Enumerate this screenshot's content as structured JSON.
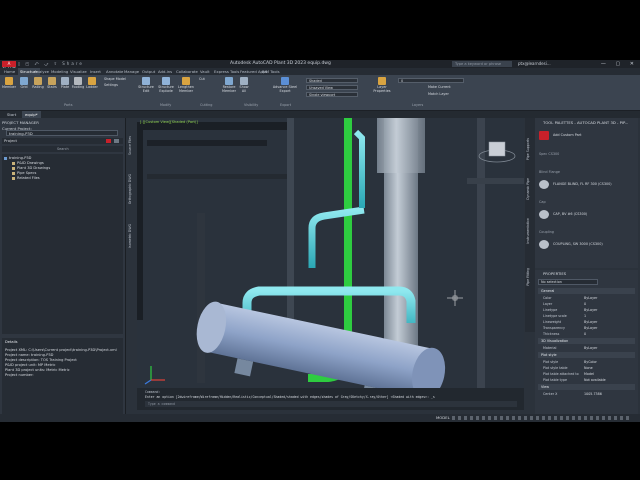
{
  "app": {
    "logo": "A PLANT",
    "title": "Autodesk AutoCAD Plant 3D 2023   equip.dwg",
    "search_placeholder": "Type a keyword or phrase",
    "user": "ptx@learndesi...",
    "window_buttons": "— ▢ ✕",
    "qat": "▯ ◰ ⤺ ⤻ ⇪ Share"
  },
  "ribbon_tabs": [
    "Home",
    "Structure",
    "Analyze",
    "Modeling",
    "Visualize",
    "Insert",
    "Annotate",
    "Manage",
    "Output",
    "Add-ins",
    "Collaborate",
    "Vault",
    "Express Tools",
    "Featured Apps",
    "BIM Tools"
  ],
  "active_tab": "Structure",
  "ribbon": {
    "buttons": {
      "member": "Member",
      "grid": "Grid",
      "railing": "Railing",
      "stairs": "Stairs",
      "plate": "Plate",
      "footing": "Footing",
      "ladder": "Ladder",
      "edit": "Structure Edit",
      "explode": "Structure Explode",
      "lengthen": "Lengthen Member",
      "restore": "Restore Member",
      "show_all": "Show All",
      "export": "Advance Steel Export",
      "layer_props": "Layer Properties"
    },
    "shape_model": "Shape Model",
    "settings": "Settings",
    "cutting_cut": "Cut",
    "visual_style": "Shaded",
    "view_name": "Unsaved View",
    "viewport_cfg": "Single viewport",
    "export_xml": "Export XML",
    "make_current": "Make Current",
    "match_layer": "Match Layer",
    "layer_value": "0",
    "panels": [
      "Parts",
      "Modify",
      "Cutting",
      "Visibility",
      "Export",
      "Layers"
    ]
  },
  "doc_tabs": [
    "Start",
    "equip*"
  ],
  "project_manager": {
    "title": "PROJECT MANAGER",
    "current_project_label": "Current Project:",
    "current_project": "training-P3D",
    "project_label": "Project",
    "search": "Search",
    "tree": [
      "training-P3D",
      "P&ID Drawings",
      "Plant 3D Drawings",
      "Pipe Specs",
      "Related Files"
    ],
    "details_title": "Details",
    "details": [
      "Project XML: C:\\Users\\Current project\\training-P3D\\Project.xml",
      "Project name: training-P3D",
      "Project description: TOS Training Project",
      "P&ID project unit: MP Metric",
      "Plant 3D project units: Metric Metric",
      "Project number:"
    ]
  },
  "side_tabs": [
    "Source Files",
    "Orthographic DWG",
    "Isometric DWG"
  ],
  "viewport": {
    "label": "[-][Custom View][Shaded (Part)]"
  },
  "tool_palettes": {
    "title": "TOOL PALETTES - AUTOCAD PLANT 3D - PIP...",
    "items": [
      {
        "label": "Add Custom Part",
        "section": ""
      },
      {
        "label": "",
        "section": "Spec CS300"
      },
      {
        "label": "FLANGE BLIND, FL RF 300 (CS300)",
        "section": "Blind Flange"
      },
      {
        "label": "CAP, BV #6 (CS300)",
        "section": "Cap"
      },
      {
        "label": "COUPLING, SW 3000 (CS300)",
        "section": "Coupling"
      }
    ],
    "vertical_tabs": [
      "Pipe Supports",
      "Dynamic Pipe",
      "Instrumentation",
      "Pipe Fitting"
    ]
  },
  "properties": {
    "title": "PROPERTIES",
    "selection": "No selection",
    "groups": [
      {
        "name": "General",
        "rows": [
          [
            "Color",
            "ByLayer"
          ],
          [
            "Layer",
            "0"
          ],
          [
            "Linetype",
            "ByLayer"
          ],
          [
            "Linetype scale",
            "1"
          ],
          [
            "Lineweight",
            "ByLayer"
          ],
          [
            "Transparency",
            "ByLayer"
          ],
          [
            "Thickness",
            "0"
          ]
        ]
      },
      {
        "name": "3D Visualization",
        "rows": [
          [
            "Material",
            "ByLayer"
          ]
        ]
      },
      {
        "name": "Plot style",
        "rows": [
          [
            "Plot style",
            "ByColor"
          ],
          [
            "Plot style table",
            "None"
          ],
          [
            "Plot table attached to",
            "Model"
          ],
          [
            "Plot table type",
            "Not available"
          ]
        ]
      },
      {
        "name": "View",
        "rows": [
          [
            "Center X",
            "1005.7386"
          ]
        ]
      }
    ]
  },
  "command": {
    "line1": "Command:",
    "line2": "Enter an option [2dwireframe/Wireframe/Hidden/Realistic/Conceptual/Shaded/shaded with edges/shades of Gray/SKetchy/X-ray/Other] <Shaded with edges>: _s",
    "input_placeholder": "Type a command"
  },
  "status": {
    "left": "",
    "model": "MODEL"
  },
  "colors": {
    "equipment": "#8ea3c8",
    "pipe_cyan": "#4fc9d6",
    "pipe_green": "#2ecc40",
    "structure": "#9aa3ad"
  }
}
